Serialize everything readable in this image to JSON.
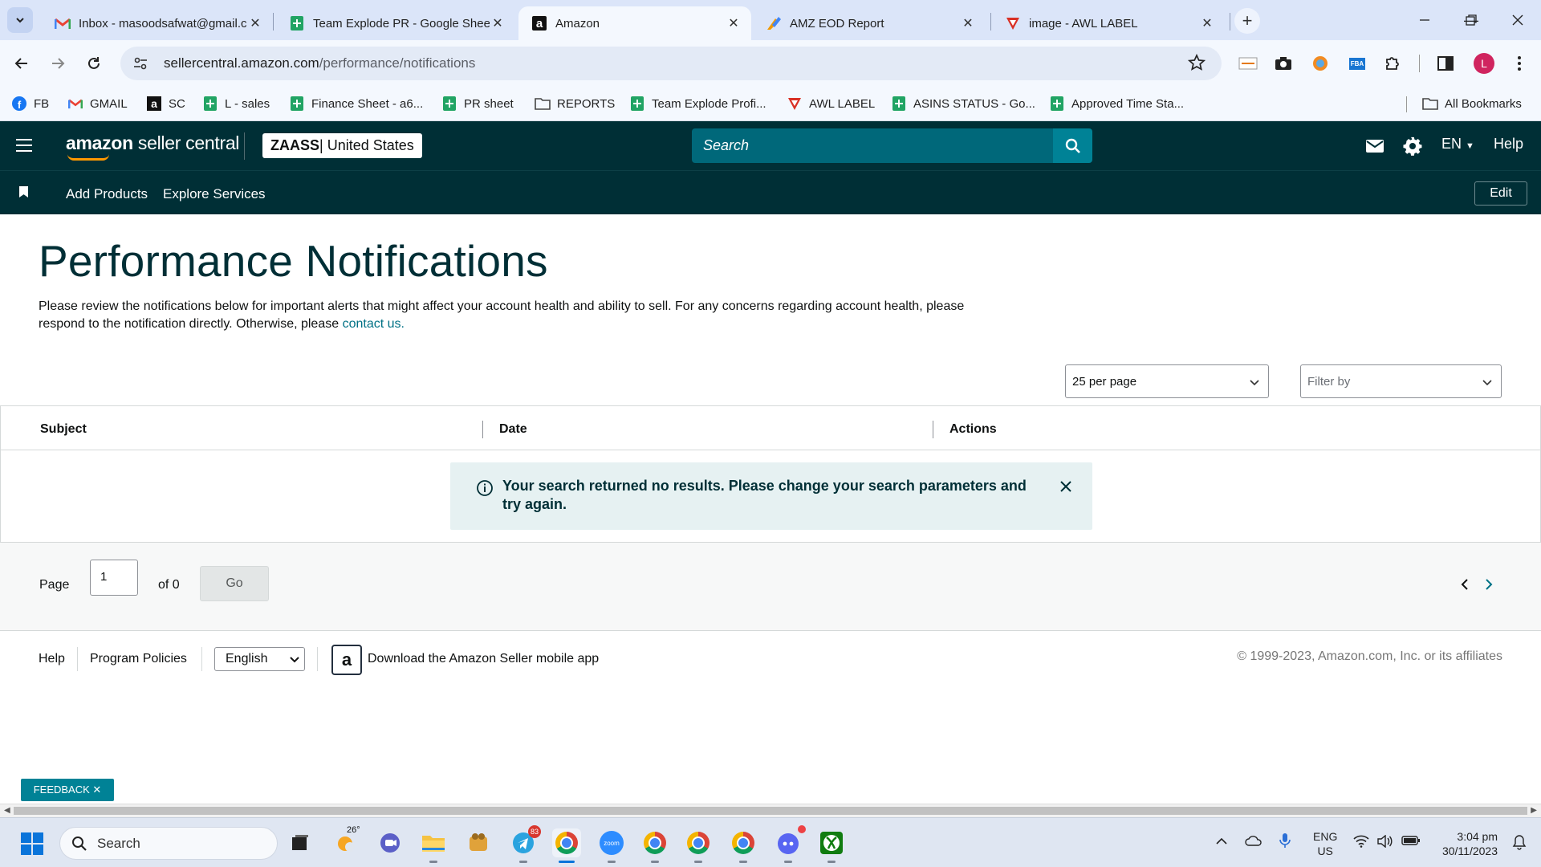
{
  "browser": {
    "tabs": [
      {
        "title": "Inbox - masoodsafwat@gmail.com",
        "icon": "gmail-icon",
        "active": false
      },
      {
        "title": "Team Explode PR - Google Sheets",
        "icon": "sheets-icon",
        "active": false
      },
      {
        "title": "Amazon",
        "icon": "amazon-icon",
        "active": true
      },
      {
        "title": "AMZ EOD Report",
        "icon": "report-icon",
        "active": false
      },
      {
        "title": "image - AWL LABEL",
        "icon": "awl-icon",
        "active": false
      }
    ],
    "url_domain": "sellercentral.amazon.com",
    "url_path": "/performance/notifications",
    "bookmarks": [
      {
        "label": "FB",
        "icon": "facebook-icon"
      },
      {
        "label": "GMAIL",
        "icon": "gmail-icon"
      },
      {
        "label": "SC",
        "icon": "amazon-icon"
      },
      {
        "label": "L - sales",
        "icon": "sheets-icon"
      },
      {
        "label": "Finance Sheet - a6...",
        "icon": "sheets-icon"
      },
      {
        "label": "PR sheet",
        "icon": "sheets-icon"
      },
      {
        "label": "REPORTS",
        "icon": "folder-icon"
      },
      {
        "label": "Team Explode Profi...",
        "icon": "sheets-icon"
      },
      {
        "label": "AWL LABEL",
        "icon": "awl-icon"
      },
      {
        "label": "ASINS STATUS - Go...",
        "icon": "sheets-icon"
      },
      {
        "label": "Approved Time Sta...",
        "icon": "sheets-icon"
      }
    ],
    "all_bookmarks": "All Bookmarks",
    "profile_initial": "L"
  },
  "header": {
    "logo_bold": "amazon",
    "logo_rest": " seller central",
    "account_name": "ZAASS",
    "account_region": " | United States",
    "search_placeholder": "Search",
    "language": "EN",
    "help": "Help",
    "nav": [
      "Add Products",
      "Explore Services"
    ],
    "edit": "Edit"
  },
  "page": {
    "title": "Performance Notifications",
    "description": "Please review the notifications below for important alerts that might affect your account health and ability to sell. For any concerns regarding account health, please respond to the notification directly. Otherwise, please ",
    "contact_link": "contact us.",
    "per_page": "25 per page",
    "filter_placeholder": "Filter by",
    "columns": [
      "Subject",
      "Date",
      "Actions"
    ],
    "alert": "Your search returned no results. Please change your search parameters and try again.",
    "pager": {
      "label": "Page",
      "value": "1",
      "of": "of 0",
      "go": "Go"
    }
  },
  "footer": {
    "help": "Help",
    "policies": "Program Policies",
    "language": "English",
    "app_text": "Download the Amazon Seller mobile app",
    "copyright": "© 1999-2023, Amazon.com, Inc. or its affiliates"
  },
  "feedback": "FEEDBACK ✕",
  "taskbar": {
    "search": "Search",
    "weather_temp": "26°",
    "telegram_badge": "83",
    "lang_top": "ENG",
    "lang_bottom": "US",
    "time": "3:04 pm",
    "date": "30/11/2023"
  },
  "colors": {
    "sc_header": "#002f36",
    "sc_search": "#00687a",
    "accent": "#008296",
    "alert_bg": "#e6f1f2"
  }
}
